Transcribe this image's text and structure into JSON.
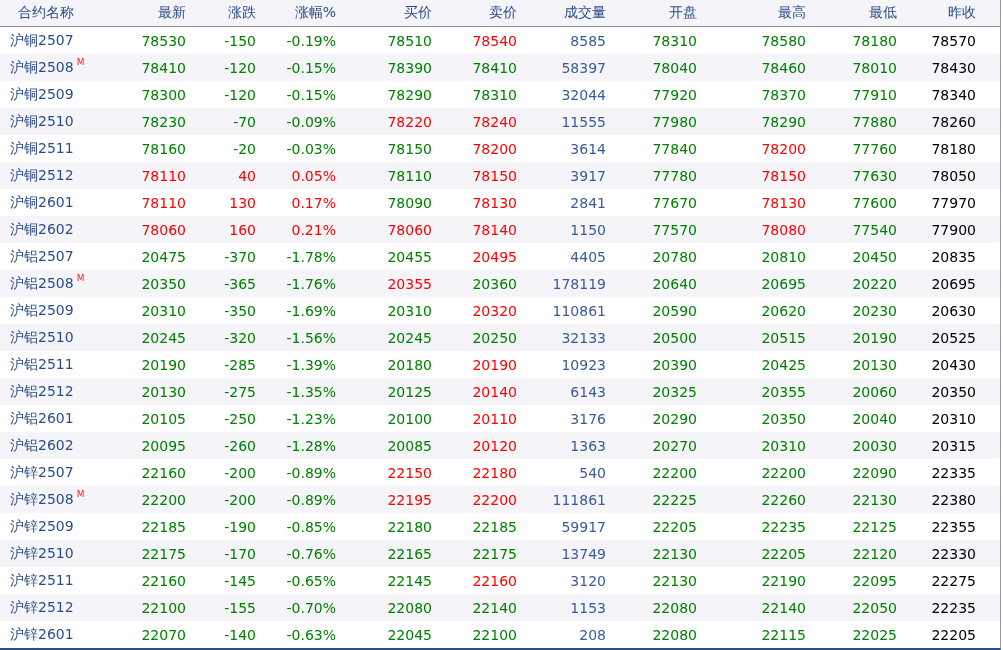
{
  "columns": [
    {
      "label": "合约名称",
      "kind": "name"
    },
    {
      "label": "最新",
      "kind": "quote"
    },
    {
      "label": "涨跌",
      "kind": "quote"
    },
    {
      "label": "涨幅%",
      "kind": "quote"
    },
    {
      "label": "买价",
      "kind": "quote"
    },
    {
      "label": "卖价",
      "kind": "quote"
    },
    {
      "label": "成交量",
      "kind": "volume"
    },
    {
      "label": "开盘",
      "kind": "quote"
    },
    {
      "label": "最高",
      "kind": "quote"
    },
    {
      "label": "最低",
      "kind": "quote"
    },
    {
      "label": "昨收",
      "kind": "plain"
    }
  ],
  "rows": [
    {
      "name": "沪铜2507",
      "cells": [
        {
          "text": "78530",
          "up": false
        },
        {
          "text": "-150",
          "up": false
        },
        {
          "text": "-0.19%",
          "up": false
        },
        {
          "text": "78510",
          "up": false
        },
        {
          "text": "78540",
          "up": true
        },
        {
          "text": "8585"
        },
        {
          "text": "78310",
          "up": false
        },
        {
          "text": "78580",
          "up": false
        },
        {
          "text": "78180",
          "up": false
        },
        {
          "text": "78570"
        }
      ]
    },
    {
      "name": "沪铜2508",
      "badge": "M",
      "cells": [
        {
          "text": "78410",
          "up": false
        },
        {
          "text": "-120",
          "up": false
        },
        {
          "text": "-0.15%",
          "up": false
        },
        {
          "text": "78390",
          "up": false
        },
        {
          "text": "78410",
          "up": false
        },
        {
          "text": "58397"
        },
        {
          "text": "78040",
          "up": false
        },
        {
          "text": "78460",
          "up": false
        },
        {
          "text": "78010",
          "up": false
        },
        {
          "text": "78430"
        }
      ]
    },
    {
      "name": "沪铜2509",
      "cells": [
        {
          "text": "78300",
          "up": false
        },
        {
          "text": "-120",
          "up": false
        },
        {
          "text": "-0.15%",
          "up": false
        },
        {
          "text": "78290",
          "up": false
        },
        {
          "text": "78310",
          "up": false
        },
        {
          "text": "32044"
        },
        {
          "text": "77920",
          "up": false
        },
        {
          "text": "78370",
          "up": false
        },
        {
          "text": "77910",
          "up": false
        },
        {
          "text": "78340"
        }
      ]
    },
    {
      "name": "沪铜2510",
      "cells": [
        {
          "text": "78230",
          "up": false
        },
        {
          "text": "-70",
          "up": false
        },
        {
          "text": "-0.09%",
          "up": false
        },
        {
          "text": "78220",
          "up": true
        },
        {
          "text": "78240",
          "up": true
        },
        {
          "text": "11555"
        },
        {
          "text": "77980",
          "up": false
        },
        {
          "text": "78290",
          "up": false
        },
        {
          "text": "77880",
          "up": false
        },
        {
          "text": "78260"
        }
      ]
    },
    {
      "name": "沪铜2511",
      "cells": [
        {
          "text": "78160",
          "up": false
        },
        {
          "text": "-20",
          "up": false
        },
        {
          "text": "-0.03%",
          "up": false
        },
        {
          "text": "78150",
          "up": false
        },
        {
          "text": "78200",
          "up": true
        },
        {
          "text": "3614"
        },
        {
          "text": "77840",
          "up": false
        },
        {
          "text": "78200",
          "up": true
        },
        {
          "text": "77760",
          "up": false
        },
        {
          "text": "78180"
        }
      ]
    },
    {
      "name": "沪铜2512",
      "cells": [
        {
          "text": "78110",
          "up": true
        },
        {
          "text": "40",
          "up": true
        },
        {
          "text": "0.05%",
          "up": true
        },
        {
          "text": "78110",
          "up": false
        },
        {
          "text": "78150",
          "up": true
        },
        {
          "text": "3917"
        },
        {
          "text": "77780",
          "up": false
        },
        {
          "text": "78150",
          "up": true
        },
        {
          "text": "77630",
          "up": false
        },
        {
          "text": "78050"
        }
      ]
    },
    {
      "name": "沪铜2601",
      "cells": [
        {
          "text": "78110",
          "up": true
        },
        {
          "text": "130",
          "up": true
        },
        {
          "text": "0.17%",
          "up": true
        },
        {
          "text": "78090",
          "up": false
        },
        {
          "text": "78130",
          "up": true
        },
        {
          "text": "2841"
        },
        {
          "text": "77670",
          "up": false
        },
        {
          "text": "78130",
          "up": true
        },
        {
          "text": "77600",
          "up": false
        },
        {
          "text": "77970"
        }
      ]
    },
    {
      "name": "沪铜2602",
      "cells": [
        {
          "text": "78060",
          "up": true
        },
        {
          "text": "160",
          "up": true
        },
        {
          "text": "0.21%",
          "up": true
        },
        {
          "text": "78060",
          "up": true
        },
        {
          "text": "78140",
          "up": true
        },
        {
          "text": "1150"
        },
        {
          "text": "77570",
          "up": false
        },
        {
          "text": "78080",
          "up": true
        },
        {
          "text": "77540",
          "up": false
        },
        {
          "text": "77900"
        }
      ]
    },
    {
      "name": "沪铝2507",
      "cells": [
        {
          "text": "20475",
          "up": false
        },
        {
          "text": "-370",
          "up": false
        },
        {
          "text": "-1.78%",
          "up": false
        },
        {
          "text": "20455",
          "up": false
        },
        {
          "text": "20495",
          "up": true
        },
        {
          "text": "4405"
        },
        {
          "text": "20780",
          "up": false
        },
        {
          "text": "20810",
          "up": false
        },
        {
          "text": "20450",
          "up": false
        },
        {
          "text": "20835"
        }
      ]
    },
    {
      "name": "沪铝2508",
      "badge": "M",
      "cells": [
        {
          "text": "20350",
          "up": false
        },
        {
          "text": "-365",
          "up": false
        },
        {
          "text": "-1.76%",
          "up": false
        },
        {
          "text": "20355",
          "up": true
        },
        {
          "text": "20360",
          "up": false
        },
        {
          "text": "178119"
        },
        {
          "text": "20640",
          "up": false
        },
        {
          "text": "20695",
          "up": false
        },
        {
          "text": "20220",
          "up": false
        },
        {
          "text": "20695"
        }
      ]
    },
    {
      "name": "沪铝2509",
      "cells": [
        {
          "text": "20310",
          "up": false
        },
        {
          "text": "-350",
          "up": false
        },
        {
          "text": "-1.69%",
          "up": false
        },
        {
          "text": "20310",
          "up": false
        },
        {
          "text": "20320",
          "up": true
        },
        {
          "text": "110861"
        },
        {
          "text": "20590",
          "up": false
        },
        {
          "text": "20620",
          "up": false
        },
        {
          "text": "20230",
          "up": false
        },
        {
          "text": "20630"
        }
      ]
    },
    {
      "name": "沪铝2510",
      "cells": [
        {
          "text": "20245",
          "up": false
        },
        {
          "text": "-320",
          "up": false
        },
        {
          "text": "-1.56%",
          "up": false
        },
        {
          "text": "20245",
          "up": false
        },
        {
          "text": "20250",
          "up": false
        },
        {
          "text": "32133"
        },
        {
          "text": "20500",
          "up": false
        },
        {
          "text": "20515",
          "up": false
        },
        {
          "text": "20190",
          "up": false
        },
        {
          "text": "20525"
        }
      ]
    },
    {
      "name": "沪铝2511",
      "cells": [
        {
          "text": "20190",
          "up": false
        },
        {
          "text": "-285",
          "up": false
        },
        {
          "text": "-1.39%",
          "up": false
        },
        {
          "text": "20180",
          "up": false
        },
        {
          "text": "20190",
          "up": true
        },
        {
          "text": "10923"
        },
        {
          "text": "20390",
          "up": false
        },
        {
          "text": "20425",
          "up": false
        },
        {
          "text": "20130",
          "up": false
        },
        {
          "text": "20430"
        }
      ]
    },
    {
      "name": "沪铝2512",
      "cells": [
        {
          "text": "20130",
          "up": false
        },
        {
          "text": "-275",
          "up": false
        },
        {
          "text": "-1.35%",
          "up": false
        },
        {
          "text": "20125",
          "up": false
        },
        {
          "text": "20140",
          "up": true
        },
        {
          "text": "6143"
        },
        {
          "text": "20325",
          "up": false
        },
        {
          "text": "20355",
          "up": false
        },
        {
          "text": "20060",
          "up": false
        },
        {
          "text": "20350"
        }
      ]
    },
    {
      "name": "沪铝2601",
      "cells": [
        {
          "text": "20105",
          "up": false
        },
        {
          "text": "-250",
          "up": false
        },
        {
          "text": "-1.23%",
          "up": false
        },
        {
          "text": "20100",
          "up": false
        },
        {
          "text": "20110",
          "up": true
        },
        {
          "text": "3176"
        },
        {
          "text": "20290",
          "up": false
        },
        {
          "text": "20350",
          "up": false
        },
        {
          "text": "20040",
          "up": false
        },
        {
          "text": "20310"
        }
      ]
    },
    {
      "name": "沪铝2602",
      "cells": [
        {
          "text": "20095",
          "up": false
        },
        {
          "text": "-260",
          "up": false
        },
        {
          "text": "-1.28%",
          "up": false
        },
        {
          "text": "20085",
          "up": false
        },
        {
          "text": "20120",
          "up": true
        },
        {
          "text": "1363"
        },
        {
          "text": "20270",
          "up": false
        },
        {
          "text": "20310",
          "up": false
        },
        {
          "text": "20030",
          "up": false
        },
        {
          "text": "20315"
        }
      ]
    },
    {
      "name": "沪锌2507",
      "cells": [
        {
          "text": "22160",
          "up": false
        },
        {
          "text": "-200",
          "up": false
        },
        {
          "text": "-0.89%",
          "up": false
        },
        {
          "text": "22150",
          "up": true
        },
        {
          "text": "22180",
          "up": true
        },
        {
          "text": "540"
        },
        {
          "text": "22200",
          "up": false
        },
        {
          "text": "22200",
          "up": false
        },
        {
          "text": "22090",
          "up": false
        },
        {
          "text": "22335"
        }
      ]
    },
    {
      "name": "沪锌2508",
      "badge": "M",
      "cells": [
        {
          "text": "22200",
          "up": false
        },
        {
          "text": "-200",
          "up": false
        },
        {
          "text": "-0.89%",
          "up": false
        },
        {
          "text": "22195",
          "up": true
        },
        {
          "text": "22200",
          "up": true
        },
        {
          "text": "111861"
        },
        {
          "text": "22225",
          "up": false
        },
        {
          "text": "22260",
          "up": false
        },
        {
          "text": "22130",
          "up": false
        },
        {
          "text": "22380"
        }
      ]
    },
    {
      "name": "沪锌2509",
      "cells": [
        {
          "text": "22185",
          "up": false
        },
        {
          "text": "-190",
          "up": false
        },
        {
          "text": "-0.85%",
          "up": false
        },
        {
          "text": "22180",
          "up": false
        },
        {
          "text": "22185",
          "up": false
        },
        {
          "text": "59917"
        },
        {
          "text": "22205",
          "up": false
        },
        {
          "text": "22235",
          "up": false
        },
        {
          "text": "22125",
          "up": false
        },
        {
          "text": "22355"
        }
      ]
    },
    {
      "name": "沪锌2510",
      "cells": [
        {
          "text": "22175",
          "up": false
        },
        {
          "text": "-170",
          "up": false
        },
        {
          "text": "-0.76%",
          "up": false
        },
        {
          "text": "22165",
          "up": false
        },
        {
          "text": "22175",
          "up": false
        },
        {
          "text": "13749"
        },
        {
          "text": "22130",
          "up": false
        },
        {
          "text": "22205",
          "up": false
        },
        {
          "text": "22120",
          "up": false
        },
        {
          "text": "22330"
        }
      ]
    },
    {
      "name": "沪锌2511",
      "cells": [
        {
          "text": "22160",
          "up": false
        },
        {
          "text": "-145",
          "up": false
        },
        {
          "text": "-0.65%",
          "up": false
        },
        {
          "text": "22145",
          "up": false
        },
        {
          "text": "22160",
          "up": true
        },
        {
          "text": "3120"
        },
        {
          "text": "22130",
          "up": false
        },
        {
          "text": "22190",
          "up": false
        },
        {
          "text": "22095",
          "up": false
        },
        {
          "text": "22275"
        }
      ]
    },
    {
      "name": "沪锌2512",
      "cells": [
        {
          "text": "22100",
          "up": false
        },
        {
          "text": "-155",
          "up": false
        },
        {
          "text": "-0.70%",
          "up": false
        },
        {
          "text": "22080",
          "up": false
        },
        {
          "text": "22140",
          "up": false
        },
        {
          "text": "1153"
        },
        {
          "text": "22080",
          "up": false
        },
        {
          "text": "22140",
          "up": false
        },
        {
          "text": "22050",
          "up": false
        },
        {
          "text": "22235"
        }
      ]
    },
    {
      "name": "沪锌2601",
      "cells": [
        {
          "text": "22070",
          "up": false
        },
        {
          "text": "-140",
          "up": false
        },
        {
          "text": "-0.63%",
          "up": false
        },
        {
          "text": "22045",
          "up": false
        },
        {
          "text": "22100",
          "up": false
        },
        {
          "text": "208"
        },
        {
          "text": "22080",
          "up": false
        },
        {
          "text": "22115",
          "up": false
        },
        {
          "text": "22025",
          "up": false
        },
        {
          "text": "22205"
        }
      ]
    }
  ]
}
